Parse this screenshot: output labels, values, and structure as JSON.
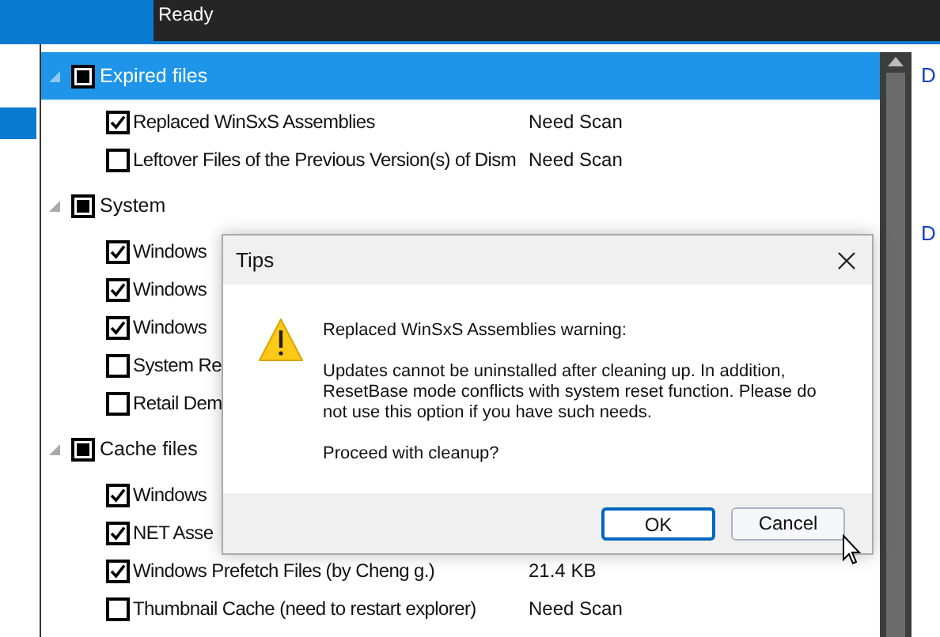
{
  "status": {
    "text": "Ready"
  },
  "side_list": {
    "items": [
      {
        "selected": true
      }
    ]
  },
  "tree": {
    "groups": [
      {
        "label": "Expired files",
        "mixed": true,
        "selected": true,
        "expanded": true,
        "items": [
          {
            "label": "Replaced WinSxS Assemblies",
            "checked": true,
            "value": "Need Scan"
          },
          {
            "label": "Leftover Files of the Previous Version(s) of Dism",
            "checked": false,
            "value": "Need Scan"
          }
        ]
      },
      {
        "label": "System",
        "mixed": true,
        "selected": false,
        "expanded": true,
        "items": [
          {
            "label": "Windows",
            "checked": true
          },
          {
            "label": "Windows",
            "checked": true
          },
          {
            "label": "Windows",
            "checked": true
          },
          {
            "label": "System Re",
            "checked": false
          },
          {
            "label": "Retail Dem",
            "checked": false
          }
        ]
      },
      {
        "label": "Cache files",
        "mixed": true,
        "selected": false,
        "expanded": true,
        "items": [
          {
            "label": "Windows",
            "checked": true
          },
          {
            "label": "NET Asse",
            "checked": true
          },
          {
            "label": "Windows Prefetch Files (by Cheng g.)",
            "checked": true,
            "value": "21.4 KB"
          },
          {
            "label": "Thumbnail Cache (need to restart explorer)",
            "checked": false,
            "value": "Need Scan"
          }
        ]
      }
    ]
  },
  "right_links": [
    "D",
    "D"
  ],
  "dialog": {
    "title": "Tips",
    "heading": "Replaced WinSxS Assemblies warning:",
    "body": "Updates cannot be uninstalled after cleaning up. In addition, ResetBase mode conflicts with system reset function. Please do not use this option if you have such needs.",
    "question": "Proceed with cleanup?",
    "buttons": [
      {
        "label": "OK",
        "selected": true
      },
      {
        "label": "Cancel",
        "selected": false
      }
    ]
  }
}
